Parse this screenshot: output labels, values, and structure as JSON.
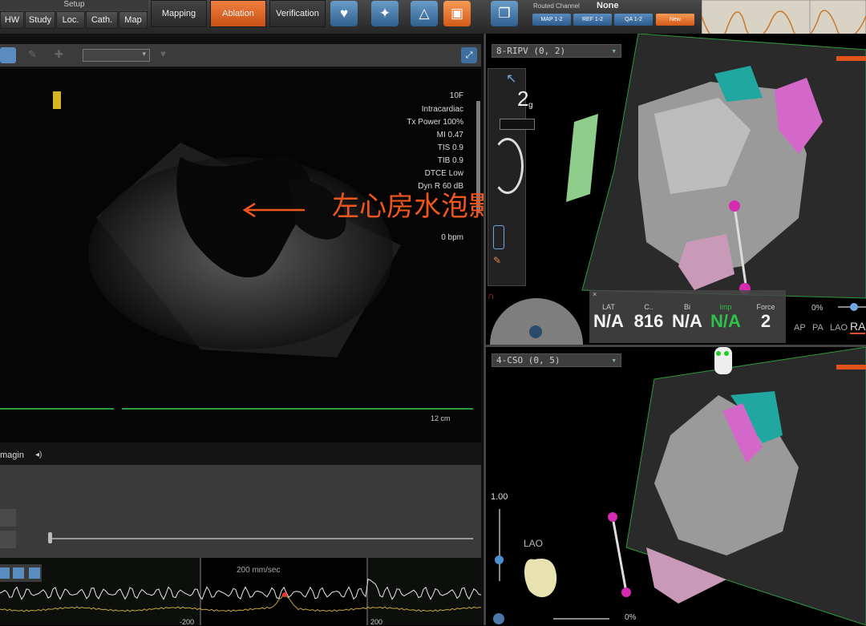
{
  "topbar": {
    "setup_label": "Setup",
    "setup_tabs": [
      "HW",
      "Study",
      "Loc.",
      "Cath.",
      "Map"
    ],
    "modes": [
      "Mapping",
      "Ablation",
      "Verification"
    ],
    "active_mode": "Ablation",
    "routed_channel_label": "Routed Channel",
    "routed_channel_value": "None",
    "channel_buttons": [
      "MAP 1-2",
      "REF 1-2",
      "QA 1-2",
      "New"
    ]
  },
  "ultrasound": {
    "params": [
      "10F",
      "Intracardiac",
      "Tx Power 100%",
      "MI 0.47",
      "TIS 0.9",
      "TIB 0.9",
      "DTCE Low",
      "Dyn R 60 dB"
    ],
    "bpm": "0 bpm",
    "scale": "12 cm",
    "annotation": "左心房水泡影",
    "imaging_label": "magin"
  },
  "ecg": {
    "speed": "200 mm/sec",
    "tick_left": "-200",
    "tick_right": "200"
  },
  "map_top": {
    "view_select": "8-RIPV (0, 2)",
    "force_value": "2",
    "force_unit": "g",
    "metrics": [
      {
        "label": "LAT",
        "value": "N/A"
      },
      {
        "label": "C..",
        "value": "816"
      },
      {
        "label": "Bi",
        "value": "N/A"
      },
      {
        "label": "Imp",
        "value": "N/A"
      },
      {
        "label": "Force",
        "value": "2"
      }
    ],
    "opacity": "0%",
    "views": [
      "AP",
      "PA",
      "LAO",
      "RA"
    ]
  },
  "map_bottom": {
    "view_select": "4-CSO (0, 5)",
    "zoom_value": "1.00",
    "orientation": "LAO",
    "opacity": "0%"
  },
  "colors": {
    "accent": "#e8641e",
    "imp_green": "#2ec24a",
    "blue": "#3a6fa3"
  }
}
